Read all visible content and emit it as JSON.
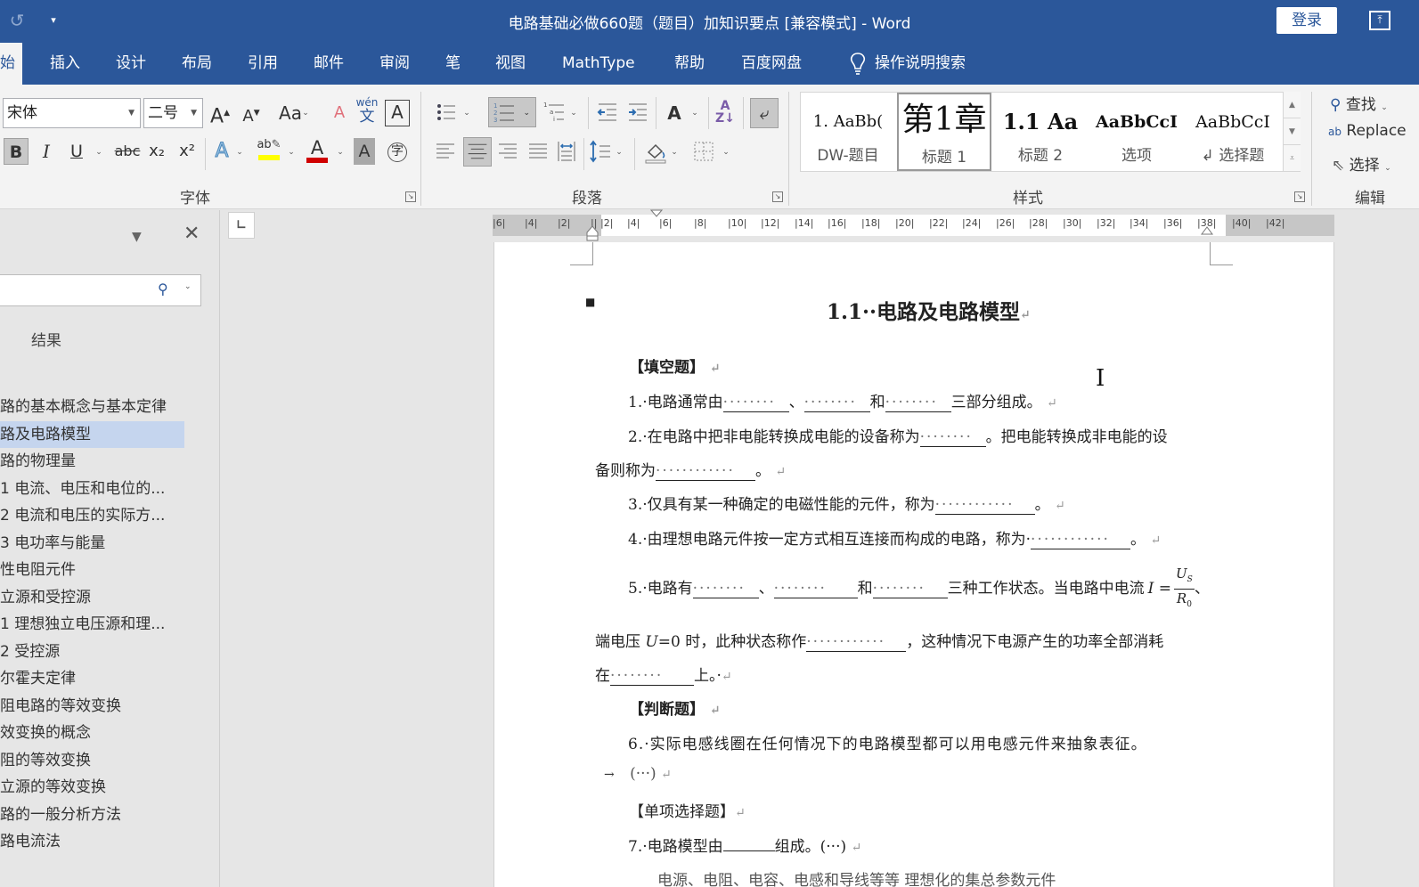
{
  "titlebar": {
    "undo_icon": "undo-icon",
    "qat_more_icon": "customize-quick-access-icon",
    "title": "电路基础必做660题（题目）加知识要点 [兼容模式]  -  Word",
    "login_label": "登录",
    "ribbon_display_icon": "ribbon-display-options-icon"
  },
  "tabs": [
    {
      "label": "始",
      "active": true
    },
    {
      "label": "插入"
    },
    {
      "label": "设计"
    },
    {
      "label": "布局"
    },
    {
      "label": "引用"
    },
    {
      "label": "邮件"
    },
    {
      "label": "审阅"
    },
    {
      "label": "笔"
    },
    {
      "label": "视图"
    },
    {
      "label": "MathType"
    },
    {
      "label": "帮助"
    },
    {
      "label": "百度网盘"
    },
    {
      "label": "操作说明搜索",
      "icon": "lightbulb-icon"
    }
  ],
  "ribbon": {
    "font": {
      "group_label": "字体",
      "font_name": "宋体",
      "font_size": "二号",
      "buttons": {
        "grow": "A",
        "shrink": "A",
        "change_case": "Aa",
        "clear_format": "A",
        "phonetic_top": "wén",
        "phonetic_bottom": "文",
        "char_border": "A",
        "bold": "B",
        "italic": "I",
        "underline": "U",
        "strike": "abc",
        "subscript": "x₂",
        "superscript": "x²",
        "text_effects": "A",
        "highlight": "ab",
        "font_color": "A",
        "char_shading": "A",
        "enclose": "字"
      },
      "highlight_color": "#ffff00",
      "font_color_bar": "#d00000"
    },
    "paragraph": {
      "group_label": "段落"
    },
    "styles": {
      "group_label": "样式",
      "items": [
        {
          "preview": "1.    AaBb(",
          "name": "DW-题目"
        },
        {
          "preview": "第1章",
          "name": "标题 1",
          "selected": true
        },
        {
          "preview": "1.1  Aa",
          "name": "标题 2"
        },
        {
          "preview": "AaBbCcI",
          "name": "选项"
        },
        {
          "preview": "AaBbCcI",
          "name": "↲ 选择题"
        }
      ]
    },
    "editing": {
      "group_label": "编辑",
      "find": "查找",
      "replace": "Replace",
      "select": "选择"
    }
  },
  "navpane": {
    "results_label": "结果",
    "search_placeholder": "",
    "items": [
      {
        "label": "路的基本概念与基本定律"
      },
      {
        "label": "路及电路模型",
        "selected": true
      },
      {
        "label": "路的物理量"
      },
      {
        "label": "1  电流、电压和电位的..."
      },
      {
        "label": "2  电流和电压的实际方..."
      },
      {
        "label": "3  电功率与能量"
      },
      {
        "label": "性电阻元件"
      },
      {
        "label": "立源和受控源"
      },
      {
        "label": "1  理想独立电压源和理..."
      },
      {
        "label": "2  受控源"
      },
      {
        "label": "尔霍夫定律"
      },
      {
        "label": "阻电路的等效变换"
      },
      {
        "label": "效变换的概念"
      },
      {
        "label": "阻的等效变换"
      },
      {
        "label": "立源的等效变换"
      },
      {
        "label": "路的一般分析方法"
      },
      {
        "label": "路电流法"
      }
    ]
  },
  "ruler": {
    "ticks": [
      "6",
      "4",
      "2",
      "",
      "2",
      "4",
      "6",
      "8",
      "10",
      "12",
      "14",
      "16",
      "18",
      "20",
      "22",
      "24",
      "26",
      "28",
      "30",
      "32",
      "34",
      "36",
      "38",
      "40",
      "42"
    ]
  },
  "document": {
    "heading": "1.1··电路及电路模型",
    "section_fill": "【填空题】",
    "q1": {
      "pre": "1.·电路通常由",
      "sep1": "、",
      "sep2": "和",
      "post": "三部分组成。"
    },
    "q2a": {
      "pre": "2.·在电路中把非电能转换成电能的设备称为",
      "post": "。把电能转换成非电能的设"
    },
    "q2b": {
      "pre": "备则称为",
      "post": "。"
    },
    "q3": {
      "pre": "3.·仅具有某一种确定的电磁性能的元件，称为",
      "post": "。"
    },
    "q4": {
      "pre": "4.·由理想电路元件按一定方式相互连接而构成的电路，称为·",
      "post": "。"
    },
    "q5a": {
      "pre": "5.·电路有",
      "sep1": "、",
      "sep2": "和",
      "post": "三种工作状态。当电路中电流",
      "var": "I =",
      "num": "U",
      "num_sub": "S",
      "den": "R",
      "den_sub": "0",
      "tail": "、"
    },
    "q5b": {
      "pre": "端电压 ",
      "var": "U",
      "mid": "=0 时，此种状态称作",
      "post": "，这种情况下电源产生的功率全部消耗"
    },
    "q5c": {
      "pre": "在",
      "post": "上。·"
    },
    "section_judge": "【判断题】",
    "q6": "6.·实际电感线圈在任何情况下的电路模型都可以用电感元件来抽象表征。",
    "q6_answer": "(···)",
    "section_single": "【单项选择题】",
    "q7": {
      "pre": "7.·电路模型由",
      "post": "组成。(···)"
    },
    "q7_option_partial": "电源、电阻、电容、电感和导线等等          理想化的集总参数元件",
    "blank_dots": "········",
    "blank_dots_long": "············",
    "paragraph_mark": "↵",
    "tab_arrow": "→"
  }
}
